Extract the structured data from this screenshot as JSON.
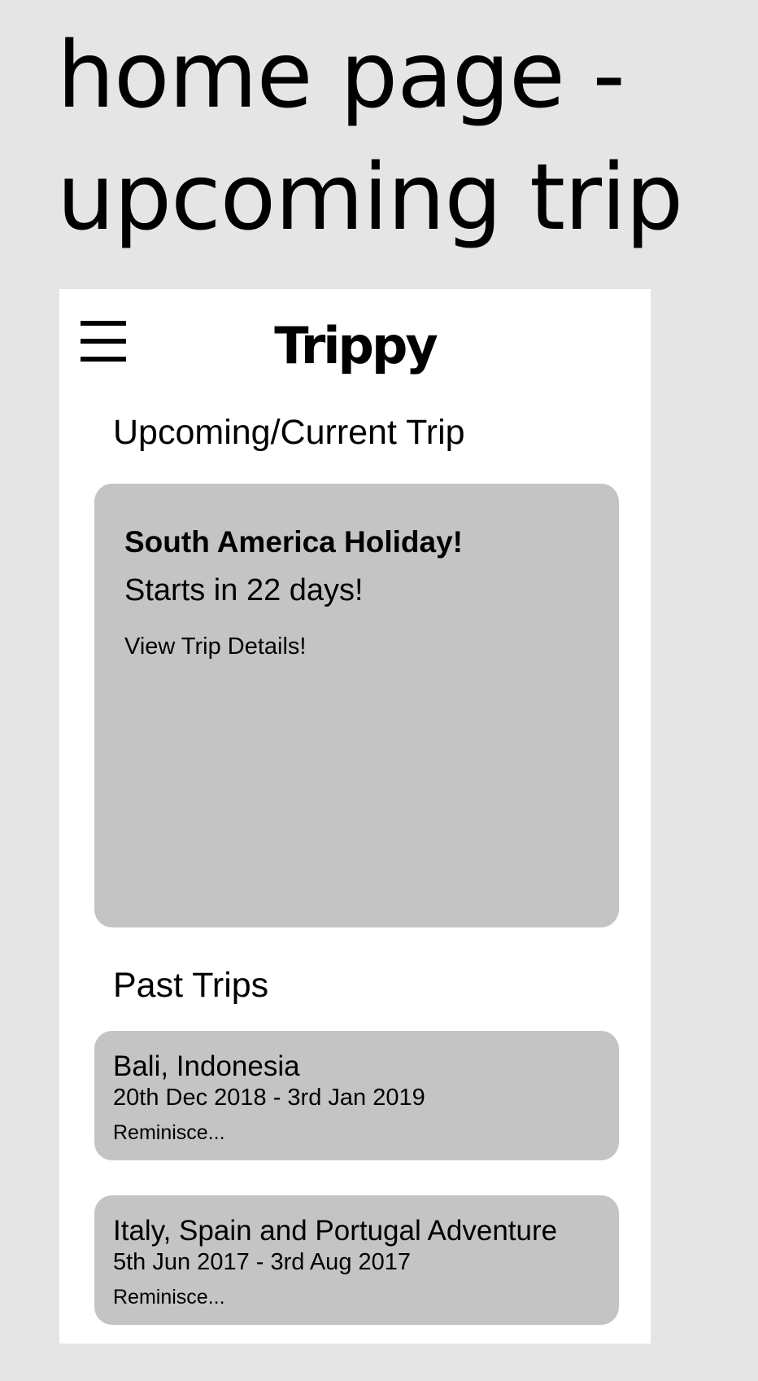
{
  "page": {
    "heading_line1": "home page -",
    "heading_line2": "upcoming trip",
    "background_color": "#e5e5e5"
  },
  "app": {
    "name": "Trippy",
    "menu_icon": "hamburger-menu-icon",
    "screen_color": "#ffffff",
    "card_color": "#c4c4c4"
  },
  "upcoming": {
    "section_title": "Upcoming/Current Trip",
    "trip_name": "South America Holiday!",
    "countdown": "Starts in 22 days!",
    "link_label": "View Trip Details!"
  },
  "past": {
    "section_title": "Past Trips",
    "trips": [
      {
        "name": "Bali, Indonesia",
        "dates": "20th Dec 2018 - 3rd Jan 2019",
        "link_label": "Reminisce..."
      },
      {
        "name": "Italy, Spain and Portugal Adventure",
        "dates": "5th Jun 2017 - 3rd Aug 2017",
        "link_label": "Reminisce..."
      }
    ]
  }
}
